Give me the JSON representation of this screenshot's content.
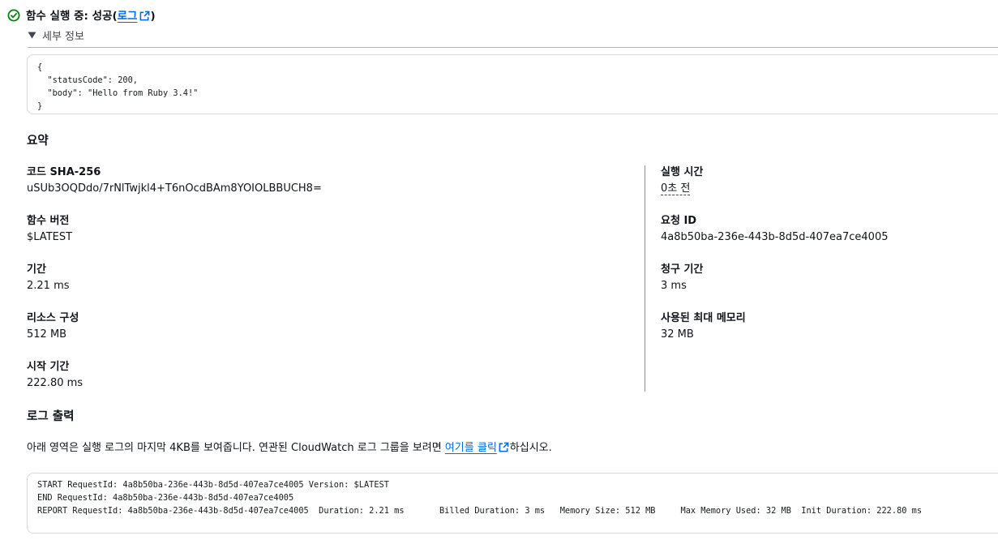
{
  "header": {
    "status_text": "함수 실행 중: 성공(",
    "log_link": "로그",
    "close_paren": ")"
  },
  "details": {
    "toggle_label": "세부 정보",
    "response_lines": [
      "{",
      "  \"statusCode\": 200,",
      "  \"body\": \"Hello from Ruby 3.4!\"",
      "}"
    ]
  },
  "summary": {
    "title": "요약",
    "left": [
      {
        "label": "코드 SHA-256",
        "value": "uSUb3OQDdo/7rNlTwjkl4+T6nOcdBAm8YOIOLBBUCH8="
      },
      {
        "label": "함수 버전",
        "value": "$LATEST"
      },
      {
        "label": "기간",
        "value": "2.21 ms"
      },
      {
        "label": "리소스 구성",
        "value": "512 MB"
      },
      {
        "label": "시작 기간",
        "value": "222.80 ms"
      }
    ],
    "right": [
      {
        "label": "실행 시간",
        "value": "0초 전"
      },
      {
        "label": "요청 ID",
        "value": "4a8b50ba-236e-443b-8d5d-407ea7ce4005"
      },
      {
        "label": "청구 기간",
        "value": "3 ms"
      },
      {
        "label": "사용된 최대 메모리",
        "value": "32 MB"
      }
    ]
  },
  "log_output": {
    "title": "로그 출력",
    "desc_before": "아래 영역은 실행 로그의 마지막 4KB를 보여줍니다. 연관된 CloudWatch 로그 그룹을 보려면 ",
    "desc_link": "여기를 클릭",
    "desc_after": "하십시오.",
    "lines": [
      "START RequestId: 4a8b50ba-236e-443b-8d5d-407ea7ce4005 Version: $LATEST",
      "END RequestId: 4a8b50ba-236e-443b-8d5d-407ea7ce4005",
      "REPORT RequestId: 4a8b50ba-236e-443b-8d5d-407ea7ce4005  Duration: 2.21 ms       Billed Duration: 3 ms   Memory Size: 512 MB     Max Memory Used: 32 MB  Init Duration: 222.80 ms"
    ]
  },
  "colors": {
    "success": "#037f0c",
    "link": "#006ce0"
  }
}
